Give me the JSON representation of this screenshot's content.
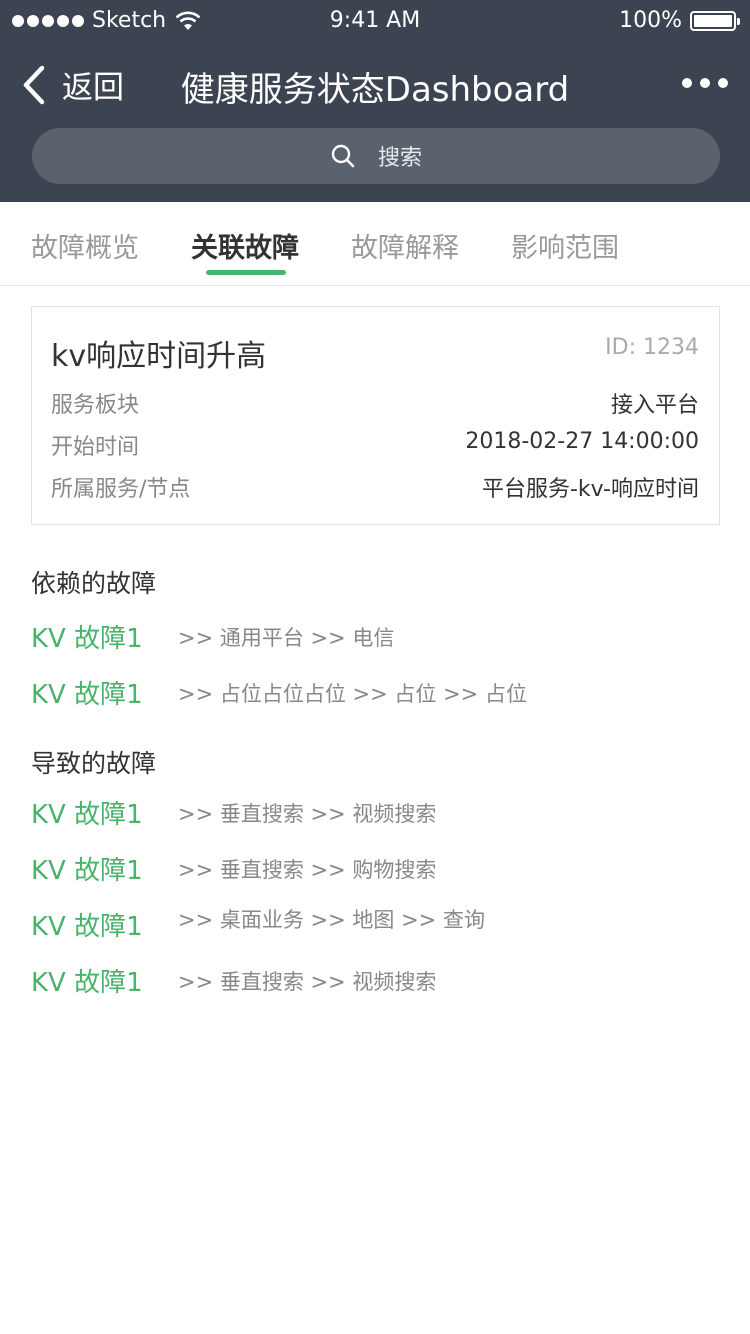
{
  "statusbar": {
    "carrier": "Sketch",
    "time": "9:41 AM",
    "battery": "100%"
  },
  "navbar": {
    "back_label": "返回",
    "title": "健康服务状态Dashboard"
  },
  "search": {
    "placeholder": "搜索"
  },
  "tabs": [
    {
      "label": "故障概览"
    },
    {
      "label": "关联故障"
    },
    {
      "label": "故障解释"
    },
    {
      "label": "影响范围"
    }
  ],
  "active_tab": "关联故障",
  "card": {
    "title": "kv响应时间升高",
    "id": "ID: 1234",
    "rows": [
      {
        "key": "服务板块",
        "value": "接入平台"
      },
      {
        "key": "开始时间",
        "value": "2018-02-27 14:00:00"
      },
      {
        "key": "所属服务/节点",
        "value": "平台服务-kv-响应时间"
      }
    ]
  },
  "dependent": {
    "title": "依赖的故障",
    "items": [
      {
        "name": "KV 故障1",
        "path": ">> 通用平台 >> 电信"
      },
      {
        "name": "KV 故障1",
        "path": ">> 占位占位占位 >> 占位 >> 占位"
      }
    ]
  },
  "caused": {
    "title": "导致的故障",
    "items": [
      {
        "name": "KV 故障1",
        "path": ">> 垂直搜索 >> 视频搜索"
      },
      {
        "name": "KV 故障1",
        "path": ">> 垂直搜索 >> 购物搜索"
      },
      {
        "name": "KV 故障1",
        "path": ">> 桌面业务 >> 地图 >> 查询"
      },
      {
        "name": "KV 故障1",
        "path": ">> 垂直搜索 >> 视频搜索"
      }
    ]
  },
  "colors": {
    "header_bg": "#3c4451",
    "accent": "#4ab36b"
  }
}
